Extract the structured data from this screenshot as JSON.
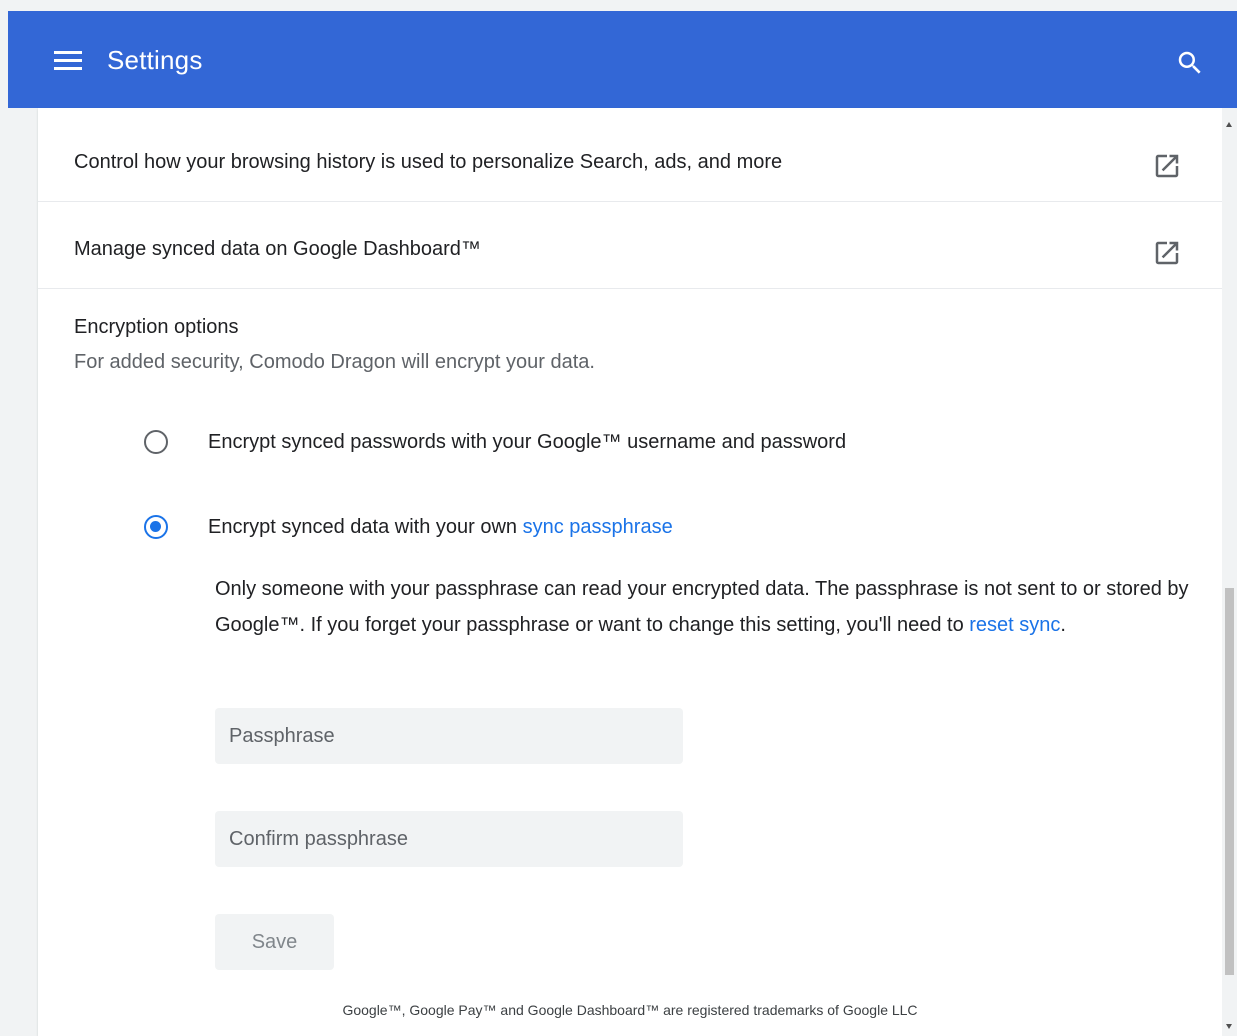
{
  "header": {
    "title": "Settings",
    "menu_icon": "hamburger-menu-icon",
    "search_icon": "search-icon",
    "background_color": "#3367d6"
  },
  "links": {
    "history_label": "Control how your browsing history is used to personalize Search, ads, and more",
    "dashboard_label": "Manage synced data on Google Dashboard™",
    "icon": "open-in-new-icon"
  },
  "encryption": {
    "title": "Encryption options",
    "subtitle": "For added security, Comodo Dragon will encrypt your data.",
    "option1_label": "Encrypt synced passwords with your Google™ username and password",
    "option2_prefix": "Encrypt synced data with your own ",
    "option2_link": "sync passphrase",
    "selected_option": 2,
    "description_part1": "Only someone with your passphrase can read your encrypted data. The passphrase is not sent to or stored by Google™. If you forget your passphrase or want to change this setting, you'll need to ",
    "description_link": "reset sync",
    "description_end": ".",
    "passphrase_placeholder": "Passphrase",
    "passphrase_value": "",
    "confirm_placeholder": "Confirm passphrase",
    "confirm_value": "",
    "save_label": "Save",
    "accent_color": "#1a73e8"
  },
  "footer": {
    "text": "Google™, Google Pay™ and Google Dashboard™ are registered trademarks of Google LLC"
  }
}
